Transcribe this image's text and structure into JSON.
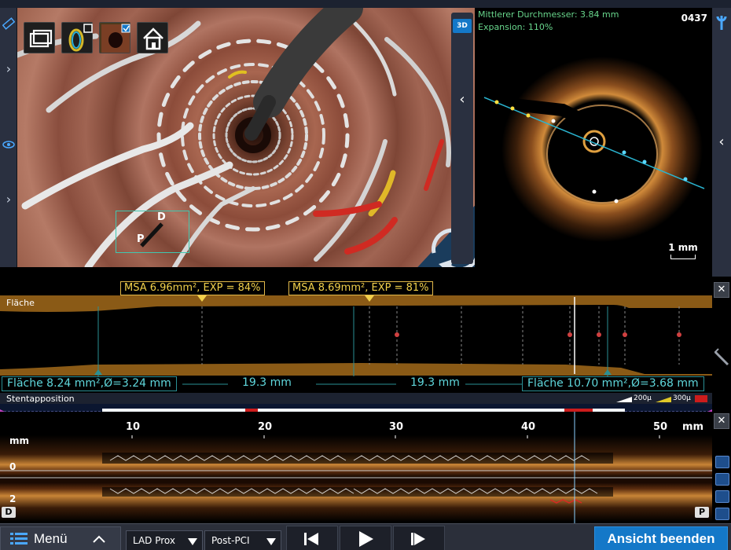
{
  "view3d": {
    "toolbar": [
      "overview-icon",
      "stent-ring-icon",
      "lumen-icon",
      "home-icon"
    ],
    "orientation": {
      "distal": "D",
      "proximal": "P"
    },
    "mode_badge": "3D"
  },
  "cross_section": {
    "mean_diameter": "Mittlerer Durchmesser:  3.84 mm",
    "expansion": "Expansion: 110%",
    "frame_number": "0437",
    "scale_label": "1 mm"
  },
  "area_graph": {
    "title": "Fläche",
    "msa_labels": [
      "MSA 6.96mm², EXP = 84%",
      "MSA 8.69mm², EXP = 81%"
    ],
    "measurements": {
      "left_ref": "Fläche 8.24 mm²,Ø=3.24 mm",
      "segment_1": "19.3 mm",
      "segment_2": "19.3 mm",
      "right_ref": "Fläche 10.70 mm²,Ø=3.68 mm"
    }
  },
  "apposition": {
    "title": "Stentapposition",
    "legend": [
      "200µ",
      "300µ"
    ]
  },
  "longitudinal": {
    "unit": "mm",
    "ticks": [
      "10",
      "20",
      "30",
      "40",
      "50",
      "mm"
    ],
    "depth_labels": [
      "mm",
      "0",
      "2"
    ],
    "markers": {
      "distal": "D",
      "proximal": "P"
    }
  },
  "bottom_bar": {
    "menu_label": "Menü",
    "vessel": "LAD Prox",
    "phase": "Post-PCI",
    "end_view": "Ansicht beenden"
  },
  "colors": {
    "accent_blue": "#1478c8",
    "msa_yellow": "#f2d14b",
    "measure_cyan": "#5fd7dc",
    "malapposition_red": "#cc1c1c"
  }
}
